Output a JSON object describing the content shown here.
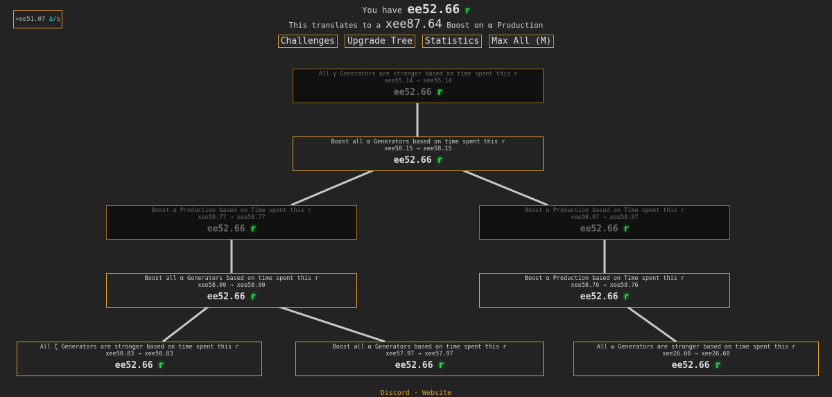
{
  "rate": {
    "value": "+ee51.07",
    "icon": "Δ",
    "suffix": "/s"
  },
  "header": {
    "you_have": "You have",
    "amount": "ee52.66",
    "currency": "r",
    "translates": "This translates to a",
    "boost": "xee87.64",
    "boost_suffix": "Boost on α Production"
  },
  "buttons": [
    "Challenges",
    "Upgrade Tree",
    "Statistics",
    "Max All (M)"
  ],
  "nodes": [
    {
      "title": "All γ Generators are stronger based on time spent this r",
      "effect": "xee55.14 → xee55.14",
      "cost": "ee52.66",
      "currency": "r",
      "state": "locked"
    },
    {
      "title": "Boost all α Generators based on time spent this r",
      "effect": "xee58.15 → xee58.15",
      "cost": "ee52.66",
      "currency": "r",
      "state": "available"
    },
    {
      "title": "Boost α Production based on Time spent this r",
      "effect": "xee58.77 → xee58.77",
      "cost": "ee52.66",
      "currency": "r",
      "state": "locked"
    },
    {
      "title": "Boost α Production based on Time spent this r",
      "effect": "xee58.97 → xee58.97",
      "cost": "ee52.66",
      "currency": "r",
      "state": "locked"
    },
    {
      "title": "Boost all α Generators based on time spent this r",
      "effect": "xee58.00 → xee58.00",
      "cost": "ee52.66",
      "currency": "r",
      "state": "available"
    },
    {
      "title": "Boost α Production based on Time spent this r",
      "effect": "xee58.76 → xee58.76",
      "cost": "ee52.66",
      "currency": "r",
      "state": "available"
    },
    {
      "title": "All ζ Generators are stronger based on time spent this r",
      "effect": "xee50.83 → xee50.83",
      "cost": "ee52.66",
      "currency": "r",
      "state": "available"
    },
    {
      "title": "Boost all α Generators based on time spent this r",
      "effect": "xee57.97 → xee57.97",
      "cost": "ee52.66",
      "currency": "r",
      "state": "available"
    },
    {
      "title": "All ω Generators are stronger based on time spent this r",
      "effect": "xee26.60 → xee26.60",
      "cost": "ee52.66",
      "currency": "r",
      "state": "available"
    }
  ],
  "footer": {
    "discord": "Discord",
    "website": "Website"
  },
  "colors": {
    "accent": "#e0a030",
    "currency": "#22e050",
    "background": "#232323"
  }
}
